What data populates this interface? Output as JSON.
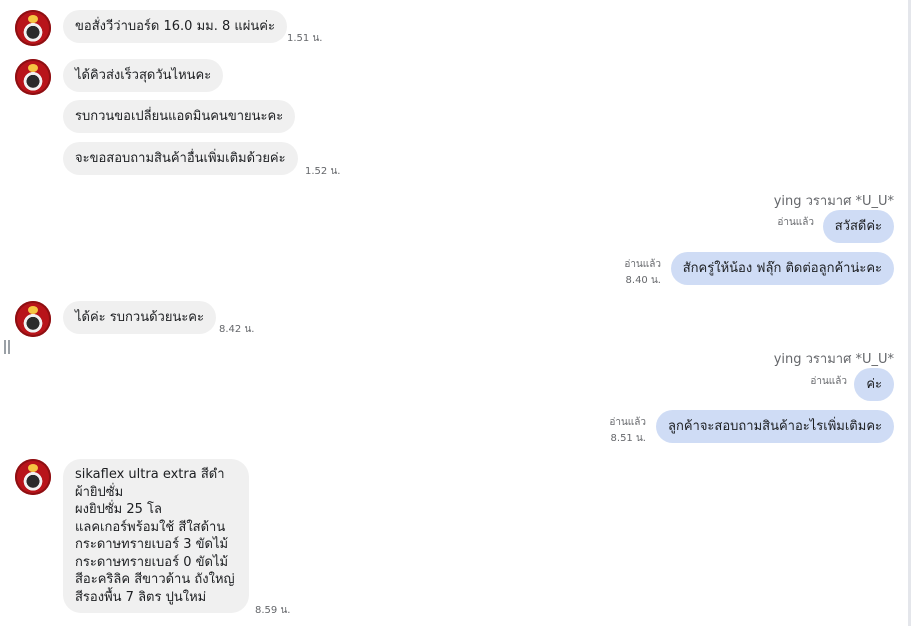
{
  "messages": {
    "m1": {
      "text": "ขอสั่งวีว่าบอร์ด 16.0 มม. 8 แผ่นค่ะ",
      "time": "1.51 น."
    },
    "m2": {
      "text": "ได้คิวส่งเร็วสุดวันไหนคะ"
    },
    "m3": {
      "text": "รบกวนขอเปลี่ยนแอดมินคนขายนะคะ"
    },
    "m4": {
      "text": "จะขอสอบถามสินค้าอื่นเพิ่มเติมด้วยค่ะ",
      "time": "1.52 น."
    },
    "sender1": "ying วรามาศ *U_U*",
    "o1": {
      "text": "สวัสดีค่ะ",
      "read": "อ่านแล้ว"
    },
    "o2": {
      "text": "สักครู่ให้น้อง ฟลุ๊ก ติดต่อลูกค้าน่ะคะ",
      "read": "อ่านแล้ว",
      "time": "8.40 น."
    },
    "m5": {
      "text": "ได้ค่ะ รบกวนด้วยนะคะ",
      "time": "8.42 น."
    },
    "sender2": "ying วรามาศ *U_U*",
    "o3": {
      "text": "ค่ะ",
      "read": "อ่านแล้ว"
    },
    "o4": {
      "text": "ลูกค้าจะสอบถามสินค้าอะไรเพิ่มเติมคะ",
      "read": "อ่านแล้ว",
      "time": "8.51 น."
    },
    "m6": {
      "text": "sikaflex ultra extra สีดำ\nผ้ายิปซั่ม\nผงยิปซั่ม 25 โล\nแลคเกอร์พร้อมใช้ สีใสด้าน\nกระดาษทรายเบอร์ 3 ขัดไม้\nกระดาษทรายเบอร์ 0 ขัดไม้\nสีอะคริลิค สีขาวด้าน ถังใหญ่\nสีรองพื้น 7 ลิตร ปูนใหม่",
      "time": "8.59 น."
    }
  },
  "colors": {
    "incoming_bubble": "#f0f0f0",
    "outgoing_bubble": "#cfdcf5",
    "meta_text": "#65676b"
  }
}
